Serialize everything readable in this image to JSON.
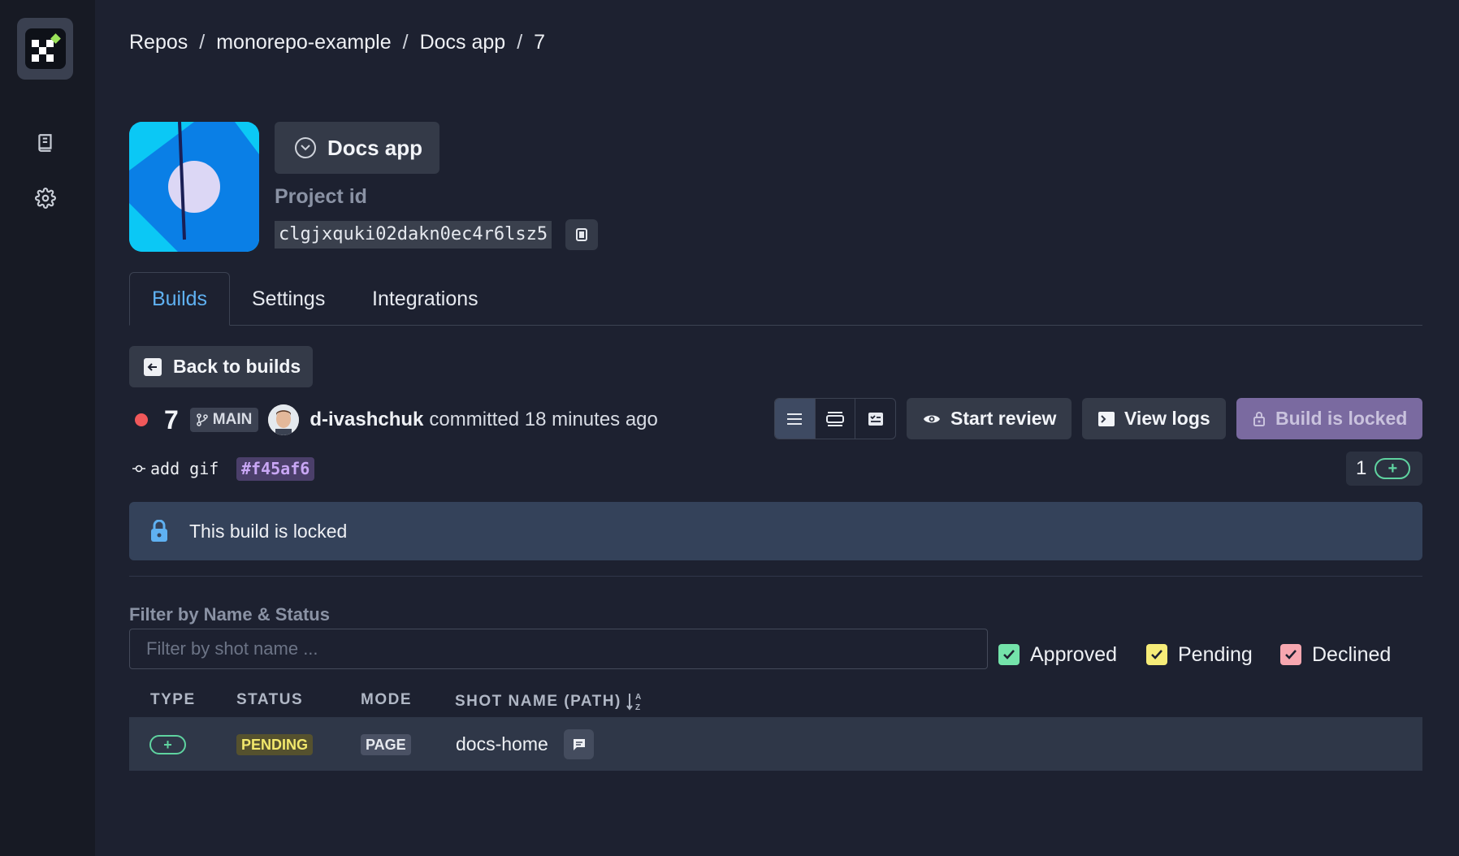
{
  "breadcrumb": {
    "items": [
      "Repos",
      "monorepo-example",
      "Docs app",
      "7"
    ],
    "separator": "/"
  },
  "sidebar": {
    "logo": "syngrisi-logo",
    "items": [
      {
        "icon": "book-icon"
      },
      {
        "icon": "gear-icon"
      }
    ]
  },
  "project": {
    "name": "Docs app",
    "id_label": "Project id",
    "id_value": "clgjxquki02dakn0ec4r6lsz5"
  },
  "tabs": [
    "Builds",
    "Settings",
    "Integrations"
  ],
  "back_button": "Back to builds",
  "build": {
    "number": "7",
    "branch": "MAIN",
    "author": "d-ivashchuk",
    "commit_time": "committed 18 minutes ago",
    "status_color": "#f0585a",
    "commit_message": "add gif",
    "sha": "#f45af6",
    "counter": "1",
    "counter_icon": "+"
  },
  "actions": {
    "start_review": "Start review",
    "view_logs": "View logs",
    "build_locked": "Build is locked"
  },
  "banner": {
    "text": "This build is locked"
  },
  "filter": {
    "label": "Filter by Name & Status",
    "placeholder": "Filter by shot name ...",
    "value": "",
    "checkboxes": [
      {
        "label": "Approved",
        "checked": true,
        "color": "#74e3aa"
      },
      {
        "label": "Pending",
        "checked": true,
        "color": "#f6ec78"
      },
      {
        "label": "Declined",
        "checked": true,
        "color": "#f7a7b0"
      }
    ]
  },
  "table": {
    "headers": [
      "TYPE",
      "STATUS",
      "MODE",
      "SHOT NAME (PATH)"
    ],
    "rows": [
      {
        "type": "+",
        "status": "PENDING",
        "mode": "PAGE",
        "name": "docs-home"
      }
    ]
  }
}
